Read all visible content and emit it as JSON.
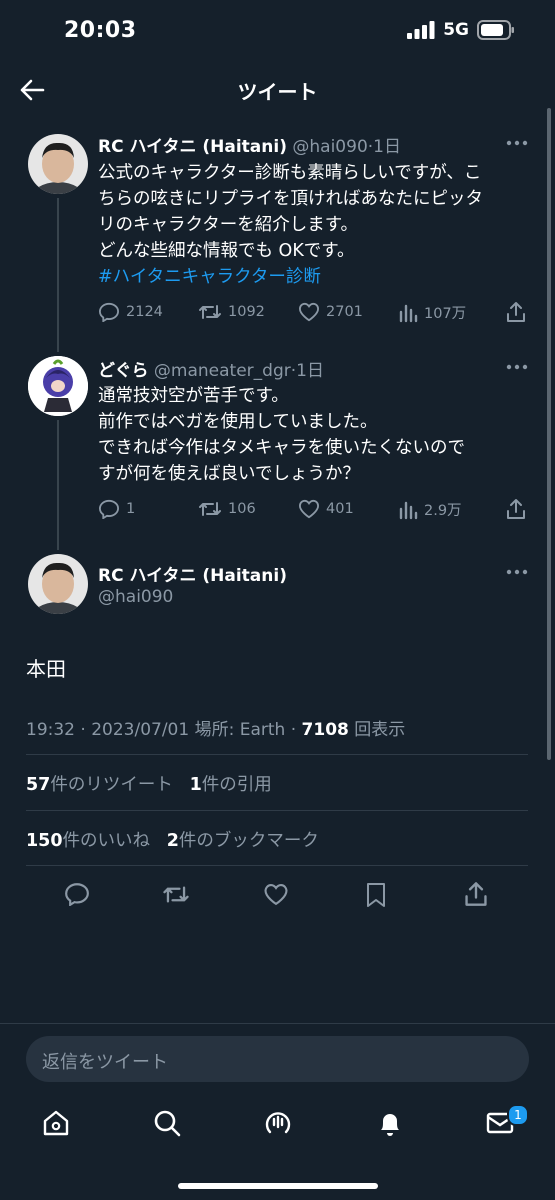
{
  "status_bar": {
    "time": "20:03",
    "network": "5G"
  },
  "header": {
    "title": "ツイート"
  },
  "thread": [
    {
      "name": "RC ハイタニ (Haitani)",
      "handle": "@hai090",
      "age": "1日",
      "lines": [
        "公式のキャラクター診断も素晴らしいですが、こ",
        "ちらの呟きにリプライを頂ければあなたにピッタ",
        "リのキャラクターを紹介します。",
        "どんな些細な情報でも OKです。"
      ],
      "hashtag": "#ハイタニキャラクター診断",
      "replies": "2124",
      "retweets": "1092",
      "likes": "2701",
      "views": "107万"
    },
    {
      "name": "どぐら",
      "handle": "@maneater_dgr",
      "age": "1日",
      "lines": [
        "通常技対空が苦手です。",
        "前作ではベガを使用していました。",
        "できれば今作はタメキャラを使いたくないので",
        "すが何を使えば良いでしょうか？"
      ],
      "replies": "1",
      "retweets": "106",
      "likes": "401",
      "views": "2.9万"
    }
  ],
  "main_tweet": {
    "name": "RC ハイタニ (Haitani)",
    "handle": "@hai090",
    "text": "本田",
    "time": "19:32 · 2023/07/01",
    "location": "場所: Earth · ",
    "views_count": "7108",
    "views_label": "回表示",
    "retweets_count": "57",
    "retweets_label": "件のリツイート",
    "quotes_count": "1",
    "quotes_label": "件の引用",
    "likes_count": "150",
    "likes_label": "件のいいね",
    "bookmarks_count": "2",
    "bookmarks_label": "件のブックマーク"
  },
  "reply": {
    "placeholder": "返信をツイート"
  },
  "tabbar": {
    "messages_badge": "1"
  },
  "colors": {
    "background": "#15202b",
    "accent": "#1d9bf0",
    "secondary_text": "#8b98a5"
  }
}
